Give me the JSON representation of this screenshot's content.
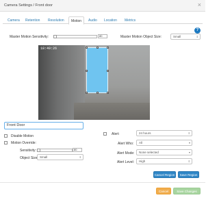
{
  "window": {
    "title": "Camera Settings / Front door"
  },
  "tabs": [
    {
      "label": "Camera"
    },
    {
      "label": "Retention"
    },
    {
      "label": "Resolution"
    },
    {
      "label": "Motion",
      "active": true
    },
    {
      "label": "Audio"
    },
    {
      "label": "Location"
    },
    {
      "label": "Metrics"
    }
  ],
  "master": {
    "sensitivity_label": "Master Motion Sensitivity:",
    "sensitivity_value": "80",
    "object_size_label": "Master Motion Object Size:",
    "object_size_value": "Small"
  },
  "preview": {
    "timestamp": "18:49:26"
  },
  "region": {
    "name": "Front Door"
  },
  "form": {
    "disable_motion": "Disable Motion",
    "motion_override": "Motion Override:",
    "sensitivity_label": "Sensitivity:",
    "sensitivity_value": "80",
    "object_size_label": "Object Size:",
    "object_size_value": "Small",
    "alert_label": "Alert:",
    "alert_value": "24 hours",
    "alert_who_label": "Alert Who:",
    "alert_who_value": "All",
    "alert_mode_label": "Alert Mode:",
    "alert_mode_value": "None selected",
    "alert_level_label": "Alert Level:",
    "alert_level_value": "High"
  },
  "buttons": {
    "cancel_region": "Cancel Region",
    "save_region": "Save Region",
    "cancel": "Cancel",
    "save_changes": "Save Changes"
  },
  "colors": {
    "primary": "#2f86c6",
    "warning": "#f0ad4e",
    "success_disabled": "#a8d5a0",
    "region_fill": "#6fc4f0",
    "link": "#2a7ab0"
  }
}
